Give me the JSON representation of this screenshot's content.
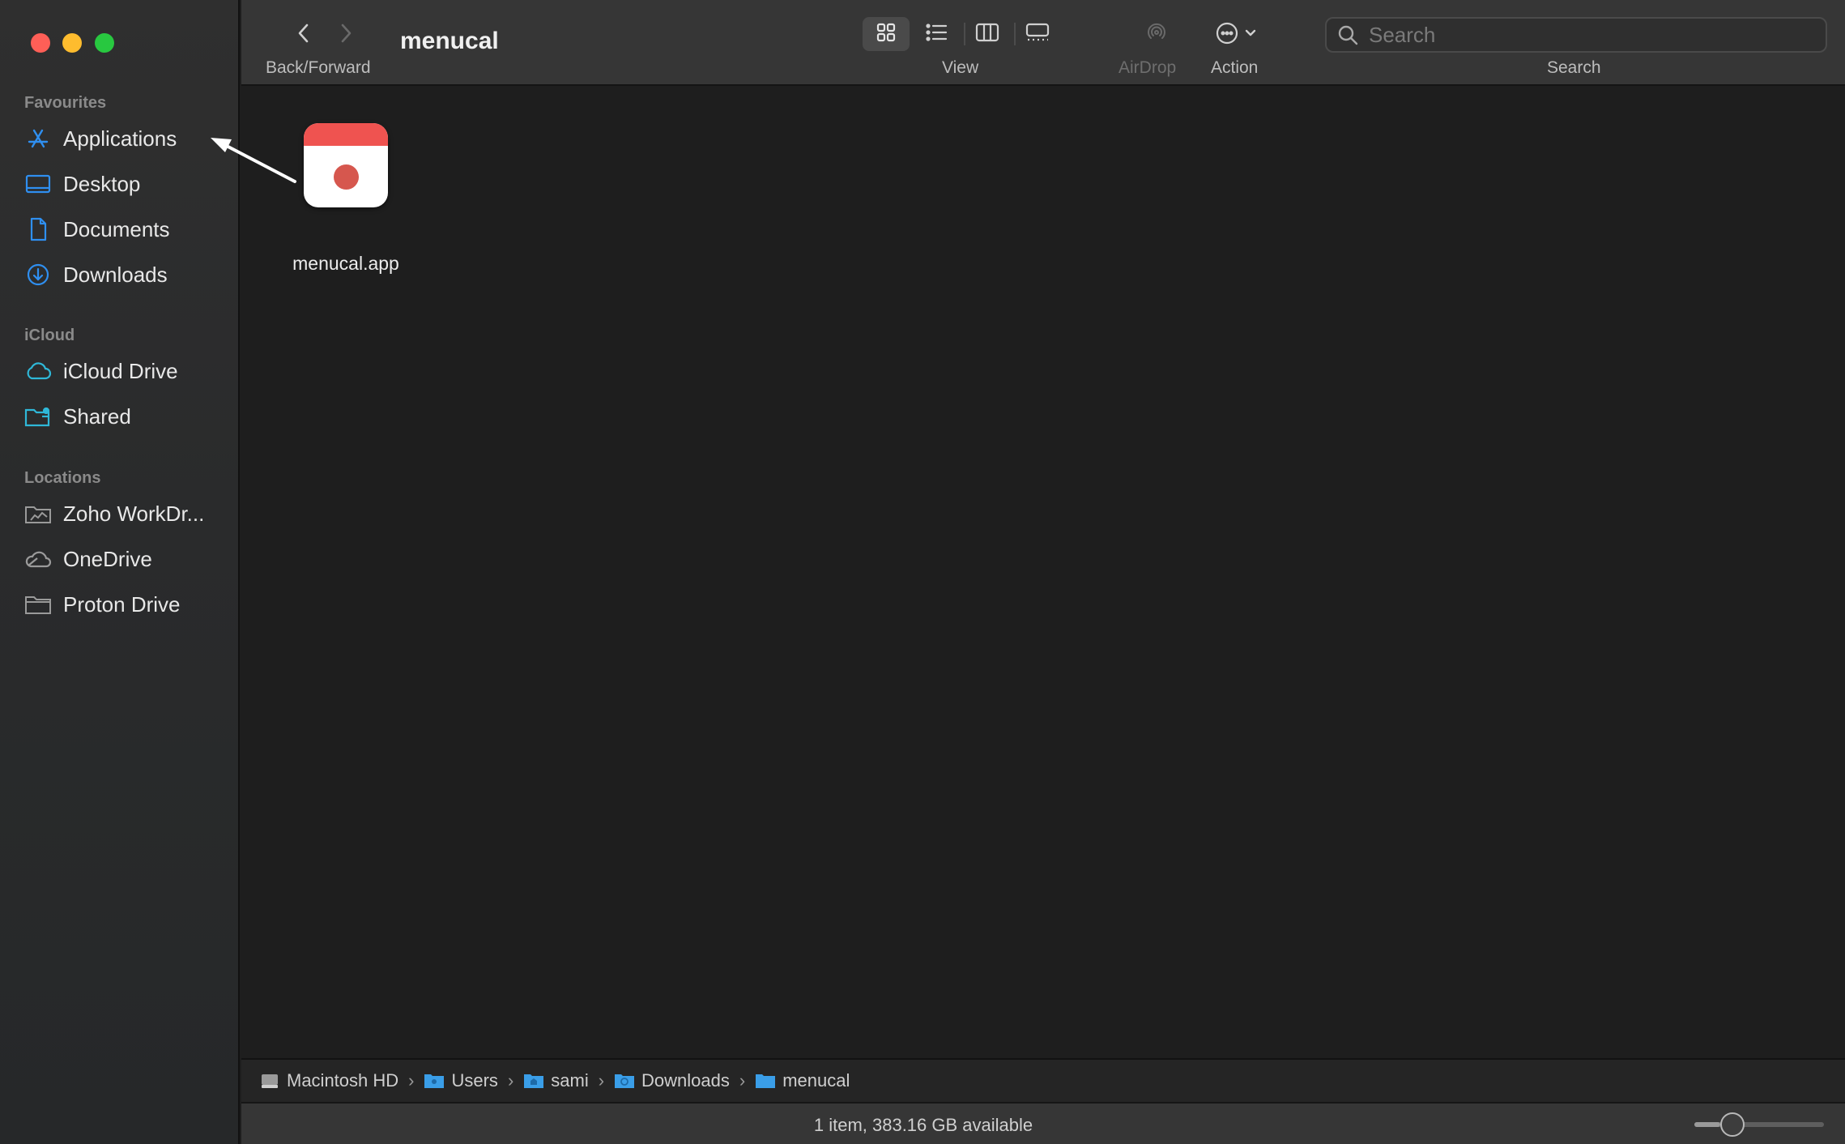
{
  "window": {
    "title": "menucal"
  },
  "sidebar": {
    "sections": [
      {
        "title": "Favourites",
        "items": [
          {
            "label": "Applications",
            "icon": "applications-icon"
          },
          {
            "label": "Desktop",
            "icon": "desktop-icon"
          },
          {
            "label": "Documents",
            "icon": "document-icon"
          },
          {
            "label": "Downloads",
            "icon": "downloads-icon"
          }
        ]
      },
      {
        "title": "iCloud",
        "items": [
          {
            "label": "iCloud Drive",
            "icon": "icloud-icon"
          },
          {
            "label": "Shared",
            "icon": "shared-folder-icon"
          }
        ]
      },
      {
        "title": "Locations",
        "items": [
          {
            "label": "Zoho WorkDr...",
            "icon": "folder-icon"
          },
          {
            "label": "OneDrive",
            "icon": "cloud-icon"
          },
          {
            "label": "Proton Drive",
            "icon": "folder-icon"
          }
        ]
      }
    ]
  },
  "toolbar": {
    "back_forward_label": "Back/Forward",
    "view_label": "View",
    "airdrop_label": "AirDrop",
    "action_label": "Action",
    "search_label": "Search",
    "search_placeholder": "Search",
    "active_view": "icon-view"
  },
  "content": {
    "items": [
      {
        "name": "menucal.app",
        "icon": "calendar-app-icon"
      }
    ]
  },
  "pathbar": {
    "crumbs": [
      {
        "label": "Macintosh HD",
        "icon": "hard-drive-icon"
      },
      {
        "label": "Users",
        "icon": "folder-icon"
      },
      {
        "label": "sami",
        "icon": "home-folder-icon"
      },
      {
        "label": "Downloads",
        "icon": "downloads-folder-icon"
      },
      {
        "label": "menucal",
        "icon": "folder-icon"
      }
    ]
  },
  "status": {
    "text": "1 item, 383.16 GB available",
    "icon_size_fraction": 0.2
  },
  "colors": {
    "accent": "#2f8ff0",
    "traffic_close": "#fe5f57",
    "traffic_min": "#febc2e",
    "traffic_max": "#28c840",
    "app_icon_red": "#ef5350"
  }
}
